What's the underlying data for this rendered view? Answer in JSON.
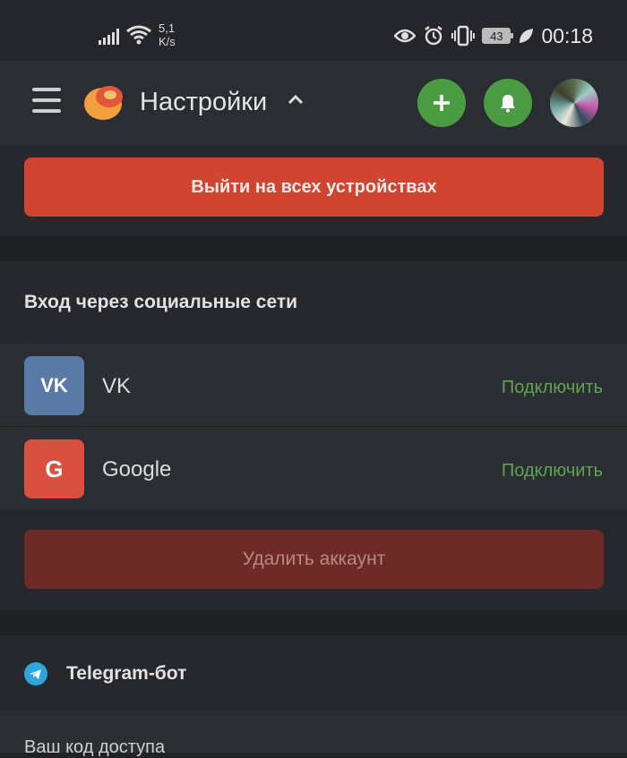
{
  "status_bar": {
    "speed_value": "5,1",
    "speed_unit": "K/s",
    "battery": "43",
    "time": "00:18"
  },
  "header": {
    "title": "Настройки"
  },
  "actions": {
    "logout_all_label": "Выйти на всех устройствах",
    "delete_account_label": "Удалить аккаунт"
  },
  "social": {
    "title": "Вход через социальные сети",
    "items": [
      {
        "name": "VK",
        "action": "Подключить",
        "icon": "vk-icon",
        "color": "#5a7aa6"
      },
      {
        "name": "Google",
        "action": "Подключить",
        "icon": "google-icon",
        "color": "#d9503f"
      }
    ]
  },
  "telegram": {
    "title": "Telegram-бот",
    "access_code_label": "Ваш код доступа"
  },
  "colors": {
    "accent_green": "#4b9b42",
    "danger_red": "#cf4532"
  }
}
